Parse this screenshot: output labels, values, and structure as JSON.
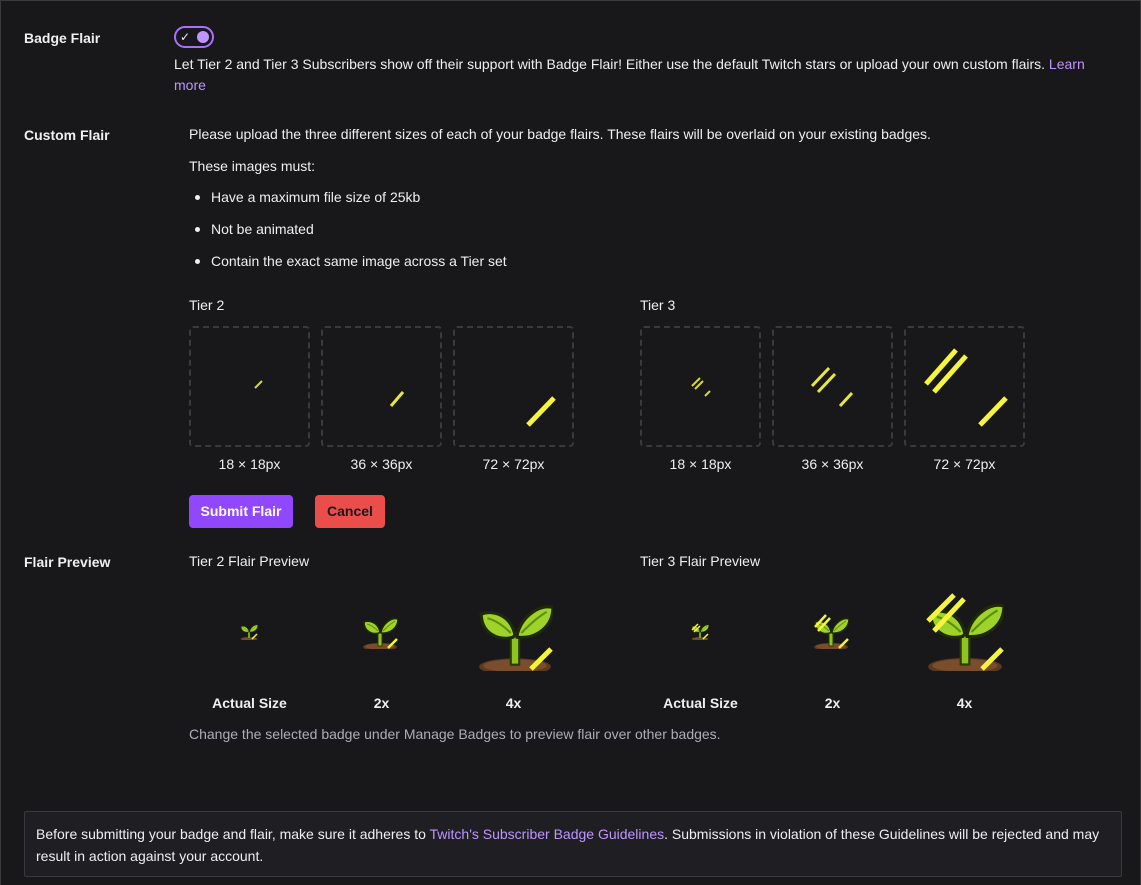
{
  "badge_flair": {
    "label": "Badge Flair",
    "enabled": true,
    "description": "Let Tier 2 and Tier 3 Subscribers show off their support with Badge Flair! Either use the default Twitch stars or upload your own custom flairs.",
    "learn_more": "Learn more"
  },
  "custom_flair": {
    "label": "Custom Flair",
    "intro": "Please upload the three different sizes of each of your badge flairs. These flairs will be overlaid on your existing badges.",
    "requirements_heading": "These images must:",
    "requirements": [
      "Have a maximum file size of 25kb",
      "Not be animated",
      "Contain the exact same image across a Tier set"
    ],
    "tiers": [
      {
        "label": "Tier 2",
        "sizes": [
          "18 × 18px",
          "36 × 36px",
          "72 × 72px"
        ]
      },
      {
        "label": "Tier 3",
        "sizes": [
          "18 × 18px",
          "36 × 36px",
          "72 × 72px"
        ]
      }
    ],
    "submit_label": "Submit Flair",
    "cancel_label": "Cancel"
  },
  "flair_preview": {
    "label": "Flair Preview",
    "tiers": [
      {
        "label": "Tier 2 Flair Preview",
        "captions": [
          "Actual Size",
          "2x",
          "4x"
        ]
      },
      {
        "label": "Tier 3 Flair Preview",
        "captions": [
          "Actual Size",
          "2x",
          "4x"
        ]
      }
    ],
    "note": "Change the selected badge under Manage Badges to preview flair over other badges."
  },
  "notice": {
    "before": "Before submitting your badge and flair, make sure it adheres to",
    "link": "Twitch's Subscriber Badge Guidelines",
    "after": ". Submissions in violation of these Guidelines will be rejected and may result in action against your account."
  },
  "colors": {
    "background": "#18181b",
    "accent": "#9147ff",
    "link": "#bf94ff",
    "danger": "#eb4d4b",
    "flair": "#f5f53c"
  }
}
